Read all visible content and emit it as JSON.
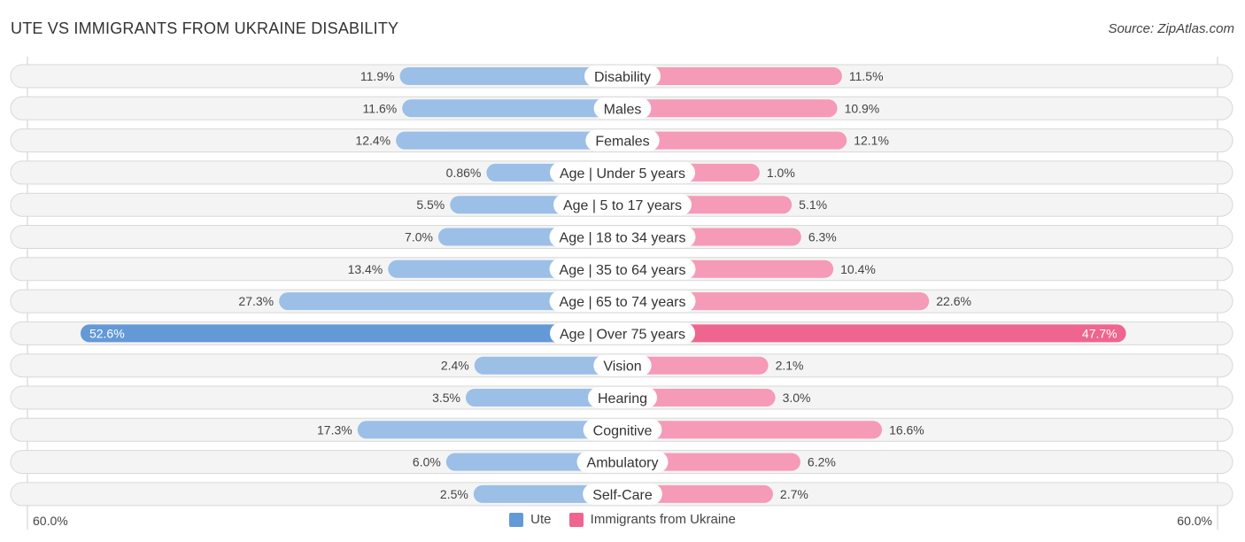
{
  "header": {
    "title": "UTE VS IMMIGRANTS FROM UKRAINE DISABILITY",
    "source": "Source: ZipAtlas.com"
  },
  "colors": {
    "left_bar": "#9bbfe6",
    "left_bar_highlight": "#6399d6",
    "right_bar": "#f59ab7",
    "right_bar_highlight": "#ef6590"
  },
  "axis": {
    "left_label": "60.0%",
    "right_label": "60.0%"
  },
  "legend": {
    "items": [
      {
        "label": "Ute",
        "color": "#6399d6"
      },
      {
        "label": "Immigrants from Ukraine",
        "color": "#ef6590"
      }
    ]
  },
  "chart_data": {
    "type": "bar",
    "orientation": "horizontal-diverging",
    "title": "UTE VS IMMIGRANTS FROM UKRAINE DISABILITY",
    "xlim": [
      -60,
      60
    ],
    "unit": "%",
    "legend_position": "bottom-center",
    "categories": [
      "Disability",
      "Males",
      "Females",
      "Age | Under 5 years",
      "Age | 5 to 17 years",
      "Age | 18 to 34 years",
      "Age | 35 to 64 years",
      "Age | 65 to 74 years",
      "Age | Over 75 years",
      "Vision",
      "Hearing",
      "Cognitive",
      "Ambulatory",
      "Self-Care"
    ],
    "series": [
      {
        "name": "Ute",
        "side": "left",
        "values": [
          11.9,
          11.6,
          12.4,
          0.86,
          5.5,
          7.0,
          13.4,
          27.3,
          52.6,
          2.4,
          3.5,
          17.3,
          6.0,
          2.5
        ],
        "labels": [
          "11.9%",
          "11.6%",
          "12.4%",
          "0.86%",
          "5.5%",
          "7.0%",
          "13.4%",
          "27.3%",
          "52.6%",
          "2.4%",
          "3.5%",
          "17.3%",
          "6.0%",
          "2.5%"
        ]
      },
      {
        "name": "Immigrants from Ukraine",
        "side": "right",
        "values": [
          11.5,
          10.9,
          12.1,
          1.0,
          5.1,
          6.3,
          10.4,
          22.6,
          47.7,
          2.1,
          3.0,
          16.6,
          6.2,
          2.7
        ],
        "labels": [
          "11.5%",
          "10.9%",
          "12.1%",
          "1.0%",
          "5.1%",
          "6.3%",
          "10.4%",
          "22.6%",
          "47.7%",
          "2.1%",
          "3.0%",
          "16.6%",
          "6.2%",
          "2.7%"
        ]
      }
    ],
    "highlight_index": 8
  }
}
